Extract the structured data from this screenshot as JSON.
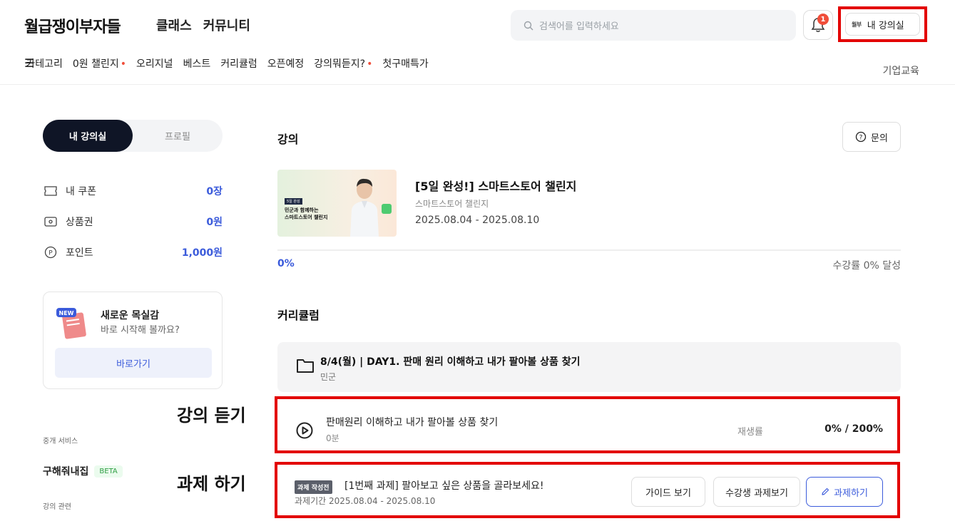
{
  "header": {
    "logo": "월급쟁이부자들",
    "nav": [
      "클래스",
      "커뮤니티"
    ],
    "search_placeholder": "검색어를 입력하세요",
    "notification_count": "1",
    "my_room_logo": "월부",
    "my_room_label": "내 강의실"
  },
  "category_nav": {
    "menu_label": "카테고리",
    "items": [
      {
        "label": "0원 챌린지",
        "dot": "•"
      },
      {
        "label": "오리지널",
        "dot": ""
      },
      {
        "label": "베스트",
        "dot": ""
      },
      {
        "label": "커리큘럼",
        "dot": ""
      },
      {
        "label": "오픈예정",
        "dot": ""
      },
      {
        "label": "강의뭐듣지?",
        "dot": "•"
      },
      {
        "label": "첫구매특가",
        "dot": ""
      }
    ],
    "corporate": "기업교육"
  },
  "sidebar": {
    "tab_active": "내 강의실",
    "tab_inactive": "프로필",
    "wallet": [
      {
        "icon": "coupon-icon",
        "label": "내 쿠폰",
        "value": "0장"
      },
      {
        "icon": "voucher-icon",
        "label": "상품권",
        "value": "0원"
      },
      {
        "icon": "point-icon",
        "label": "포인트",
        "value": "1,000원"
      }
    ],
    "promo": {
      "badge": "NEW",
      "title": "새로운 목실감",
      "subtitle": "바로 시작해 볼까요?",
      "button": "바로가기"
    },
    "section_brokerage": "중개 서비스",
    "brokerage_item": "구해줘내집",
    "brokerage_badge": "BETA",
    "section_lecture": "강의 관련"
  },
  "annotations": {
    "listen": "강의 듣기",
    "homework": "과제 하기"
  },
  "main": {
    "lecture_heading": "강의",
    "inquiry_label": "문의",
    "course": {
      "thumb_tag": "5일 완성",
      "thumb_line1": "민군과 함께하는",
      "thumb_line2": "스마트스토어 챌린지",
      "title": "[5일 완성!] 스마트스토어 챌린지",
      "subtitle": "스마트스토어 챌린지",
      "period": "2025.08.04 - 2025.08.10"
    },
    "progress": {
      "percent_text": "0%",
      "value": 0,
      "rate_text": "수강률 0% 달성"
    },
    "curriculum_heading": "커리큘럼",
    "chapter": {
      "title": "8/4(월) | DAY1. 판매 원리 이해하고 내가 팔아볼 상품 찾기",
      "author": "민군"
    },
    "lesson": {
      "title": "판매원리 이해하고 내가 팔아볼 상품 찾기",
      "duration": "0분",
      "rate_label": "재생률",
      "rate_value": "0% / 200%"
    },
    "homework": {
      "badge": "과제 작성전",
      "title": "[1번째 과제] 팔아보고 싶은 상품을 골라보세요!",
      "period": "과제기간 2025.08.04 - 2025.08.10",
      "guide_button": "가이드 보기",
      "peer_button": "수강생 과제보기",
      "do_button": "과제하기"
    }
  },
  "colors": {
    "accent": "#3b5bdb",
    "highlight_border": "#e30000",
    "dark_tab": "#0f1526",
    "badge_red": "#f04e3a"
  }
}
